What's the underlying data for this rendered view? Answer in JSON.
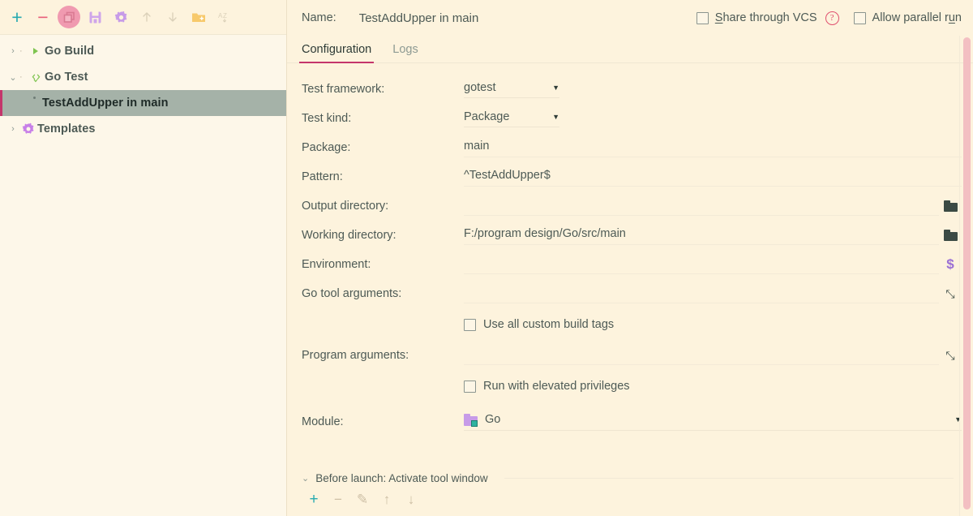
{
  "sidebar": {
    "toolbar": [
      {
        "name": "add-configuration-button",
        "icon": "plus-icon",
        "label": "+",
        "enabled": true
      },
      {
        "name": "remove-configuration-button",
        "icon": "minus-icon",
        "label": "−",
        "enabled": true
      },
      {
        "name": "copy-configuration-button",
        "icon": "copy-icon",
        "label": "",
        "enabled": true
      },
      {
        "name": "save-configuration-button",
        "icon": "save-icon",
        "label": "",
        "enabled": true
      },
      {
        "name": "edit-templates-button",
        "icon": "gear-icon",
        "label": "",
        "enabled": true
      },
      {
        "name": "move-up-button",
        "icon": "arrow-up-icon",
        "label": "",
        "enabled": false
      },
      {
        "name": "move-down-button",
        "icon": "arrow-down-icon",
        "label": "",
        "enabled": false
      },
      {
        "name": "new-folder-button",
        "icon": "folder-add-icon",
        "label": "",
        "enabled": true
      },
      {
        "name": "sort-alphabetically-button",
        "icon": "sort-az-icon",
        "label": "",
        "enabled": false
      }
    ],
    "tree": [
      {
        "label": "Go Build",
        "icon": "run-triangle-icon",
        "expanded": false,
        "selected": false,
        "chevron": "›"
      },
      {
        "label": "Go Test",
        "icon": "test-icon",
        "expanded": true,
        "selected": false,
        "chevron": "⌄"
      },
      {
        "label": "TestAddUpper in main",
        "icon": "",
        "expanded": false,
        "selected": true,
        "chevron": ""
      },
      {
        "label": "Templates",
        "icon": "gear-icon",
        "expanded": false,
        "selected": false,
        "chevron": "›"
      }
    ]
  },
  "header": {
    "name_label": "Name:",
    "name_value": "TestAddUpper in main",
    "share_vcs": {
      "label_pre": "S",
      "label_post": "hare through VCS",
      "checked": false
    },
    "help_glyph": "?",
    "parallel_run": {
      "label_pre": "Allow parallel r",
      "label_mn": "u",
      "label_post": "n",
      "checked": false
    }
  },
  "tabs": [
    {
      "label": "Configuration",
      "active": true
    },
    {
      "label": "Logs",
      "active": false
    }
  ],
  "form": {
    "test_framework": {
      "label": "Test framework:",
      "value": "gotest",
      "caret": "▼"
    },
    "test_kind": {
      "label": "Test kind:",
      "value": "Package",
      "caret": "▼"
    },
    "package": {
      "label": "Package:",
      "value": "main"
    },
    "pattern": {
      "label": "Pattern:",
      "value": "^TestAddUpper$"
    },
    "output_directory": {
      "label": "Output directory:",
      "value": "",
      "action": "browse-folder-icon"
    },
    "working_directory": {
      "label": "Working directory:",
      "value": "F:/program design/Go/src/main",
      "action": "browse-folder-icon"
    },
    "environment": {
      "label": "Environment:",
      "value": "",
      "action": "environment-variables-icon",
      "glyph": "$"
    },
    "go_tool_arguments": {
      "label": "Go tool arguments:",
      "value": "",
      "action": "expand-editor-icon",
      "glyph": "⤡"
    },
    "use_build_tags": {
      "label": "Use all custom build tags",
      "checked": false
    },
    "program_arguments": {
      "label": "Program arguments:",
      "value": "",
      "action": "expand-editor-icon",
      "glyph": "⤡"
    },
    "elevated_privileges": {
      "label": "Run with elevated privileges",
      "checked": false
    },
    "module": {
      "label": "Module:",
      "value": "Go",
      "caret": "▼",
      "icon": "module-folder-icon"
    }
  },
  "before_launch": {
    "chevron": "⌄",
    "title": "Before launch: Activate tool window",
    "toolbar": [
      {
        "name": "add-task-button",
        "glyph": "+",
        "enabled": true
      },
      {
        "name": "remove-task-button",
        "glyph": "−",
        "enabled": false
      },
      {
        "name": "edit-task-button",
        "glyph": "✎",
        "enabled": false
      },
      {
        "name": "move-task-up-button",
        "glyph": "↑",
        "enabled": false
      },
      {
        "name": "move-task-down-button",
        "glyph": "↓",
        "enabled": false
      }
    ]
  },
  "colors": {
    "background": "#fdf3dd",
    "tree_background": "#fdf7e9",
    "selection": "#a5b2a8",
    "accent": "#c4356b",
    "text": "#4d5a55",
    "teal": "#27aab0",
    "scrollbar": "#f3bfc2"
  }
}
